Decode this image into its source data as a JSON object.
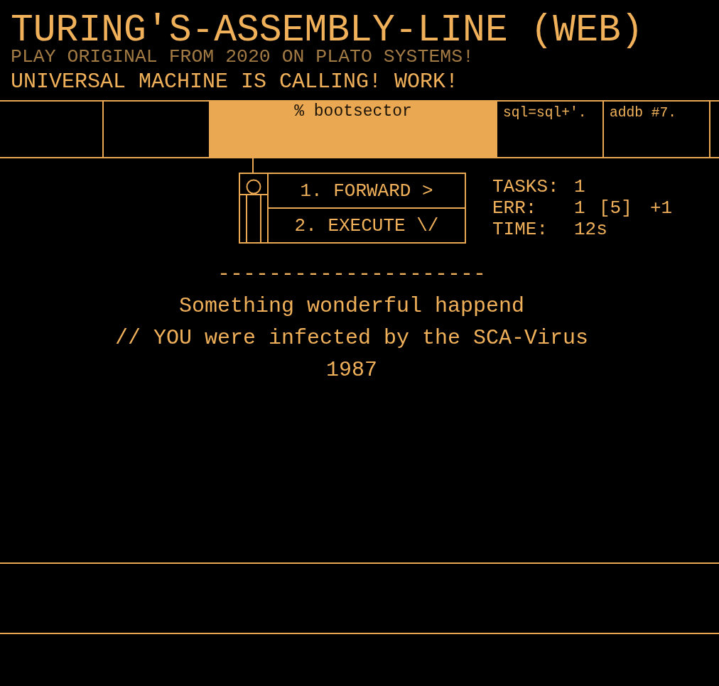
{
  "header": {
    "title": "TURING'S-ASSEMBLY-LINE (WEB)",
    "subtitle": "PLAY ORIGINAL FROM 2020 ON PLATO SYSTEMS!",
    "tagline": "UNIVERSAL MACHINE IS CALLING! WORK!"
  },
  "tape": [
    {
      "selected": false
    },
    {
      "selected": false
    },
    {
      "label": "% bootsector",
      "selected": true
    },
    {
      "label": "sql=sql+'.",
      "selected": false
    },
    {
      "label": "addb #7.",
      "selected": false
    }
  ],
  "machine": {
    "buttons": [
      {
        "label": "1. FORWARD >"
      },
      {
        "label": "2. EXECUTE \\/"
      }
    ]
  },
  "stats": [
    {
      "label": "TASKS:",
      "values": [
        "1"
      ]
    },
    {
      "label": "ERR:",
      "values": [
        "1",
        "[5]",
        "+1"
      ]
    },
    {
      "label": "TIME:",
      "values": [
        "12s"
      ]
    }
  ],
  "message": {
    "divider": "---------------------",
    "lines": [
      "Something wonderful happend",
      "// YOU were infected by the SCA-Virus",
      "1987"
    ]
  }
}
